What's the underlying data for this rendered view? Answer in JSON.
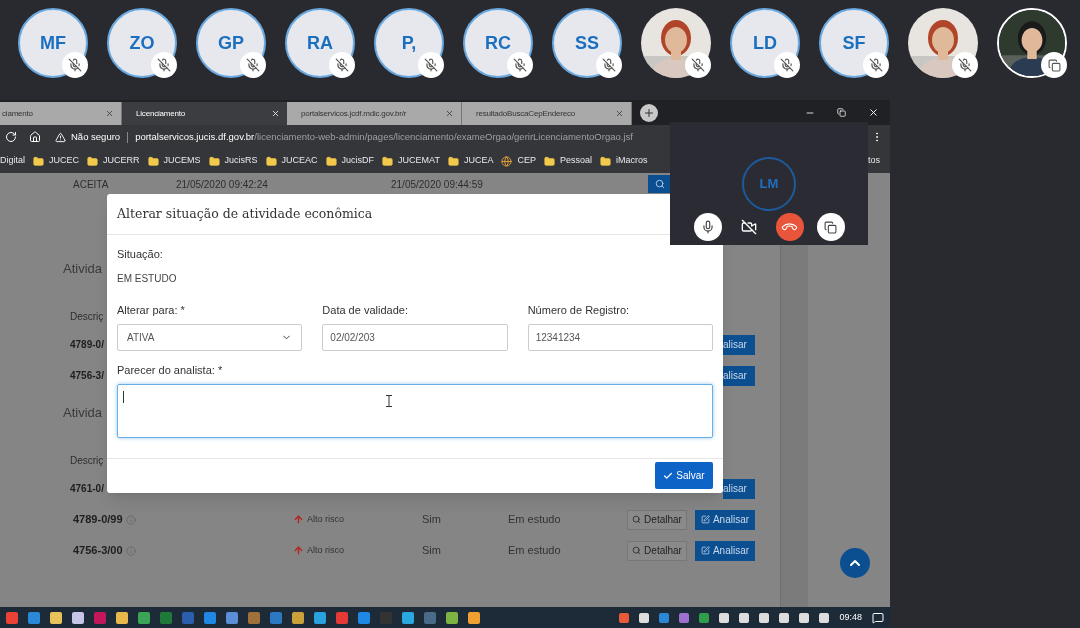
{
  "participants": [
    {
      "kind": "initials",
      "initials": "MF",
      "muted": true
    },
    {
      "kind": "initials",
      "initials": "ZO",
      "muted": true
    },
    {
      "kind": "initials",
      "initials": "GP",
      "muted": true
    },
    {
      "kind": "initials",
      "initials": "RA",
      "muted": true
    },
    {
      "kind": "initials",
      "initials": "P,",
      "muted": true
    },
    {
      "kind": "initials",
      "initials": "RC",
      "muted": true
    },
    {
      "kind": "initials",
      "initials": "SS",
      "muted": true
    },
    {
      "kind": "picture",
      "muted": true
    },
    {
      "kind": "initials",
      "initials": "LD",
      "muted": true
    },
    {
      "kind": "initials",
      "initials": "SF",
      "muted": true
    },
    {
      "kind": "picture",
      "muted": true
    },
    {
      "kind": "picture",
      "muted": false
    }
  ],
  "browser": {
    "tabs": [
      {
        "title": "ciamento",
        "selected": false
      },
      {
        "title": "Licenciamento",
        "selected": true
      },
      {
        "title": "portalservicos.jcdf.mdic.gov.br/r",
        "selected": false
      },
      {
        "title": "resultadoBuscaCepEndereco",
        "selected": false
      }
    ],
    "address": {
      "security": "Não seguro",
      "host": "portalservicos.jucis.df.gov.br",
      "path": "/licenciamento-web-admin/pages/licenciamento/exameOrgao/gerirLicenciamentoOrgao.jsf"
    },
    "bookmarks": [
      {
        "kind": "text",
        "label": "Digital"
      },
      {
        "kind": "folder",
        "label": "JUCEC"
      },
      {
        "kind": "folder",
        "label": "JUCERR"
      },
      {
        "kind": "folder",
        "label": "JUCEMS"
      },
      {
        "kind": "folder",
        "label": "JucisRS"
      },
      {
        "kind": "folder",
        "label": "JUCEAC"
      },
      {
        "kind": "folder",
        "label": "JucisDF"
      },
      {
        "kind": "folder",
        "label": "JUCEMAT"
      },
      {
        "kind": "folder",
        "label": "JUCEA"
      },
      {
        "kind": "site",
        "label": "CEP"
      },
      {
        "kind": "folder",
        "label": "Pessoal"
      },
      {
        "kind": "folder",
        "label": "iMacros"
      }
    ],
    "bookmarks_overflow": "tos"
  },
  "page": {
    "rows": [
      {
        "kind": "log",
        "status": "ACEITA",
        "start": "21/05/2020 09:42:24",
        "end": "21/05/2020 09:44:59"
      },
      {
        "kind": "heading",
        "text": "Ativida"
      },
      {
        "kind": "header",
        "text": "Descriç"
      },
      {
        "kind": "cut",
        "code": "4789-0/",
        "action": "alisar"
      },
      {
        "kind": "cut",
        "code": "4756-3/",
        "action": "alisar"
      },
      {
        "kind": "heading",
        "text": "Ativida"
      },
      {
        "kind": "header",
        "text": "Descriç"
      },
      {
        "kind": "cut",
        "code": "4761-0/",
        "action": "alisar"
      },
      {
        "kind": "full",
        "code": "4789-0/99",
        "risk": "Alto risco",
        "flag": "Sim",
        "status": "Em estudo",
        "detail": "Detalhar",
        "action": "Analisar"
      },
      {
        "kind": "full",
        "code": "4756-3/00",
        "risk": "Alto risco",
        "flag": "Sim",
        "status": "Em estudo",
        "detail": "Detalhar",
        "action": "Analisar"
      }
    ]
  },
  "modal": {
    "title": "Alterar situação de atividade econômica",
    "situation_label": "Situação:",
    "situation": "EM ESTUDO",
    "fields": [
      {
        "kind": "select",
        "label": "Alterar para: *",
        "value": "ATIVA"
      },
      {
        "kind": "input",
        "label": "Data de validade:",
        "value": "02/02/203"
      },
      {
        "kind": "input",
        "label": "Número de Registro:",
        "value": "12341234"
      }
    ],
    "opinion_label": "Parecer do analista: *",
    "save": "Salvar"
  },
  "call": {
    "initials": "LM"
  },
  "taskbar": {
    "time": "09:48"
  }
}
